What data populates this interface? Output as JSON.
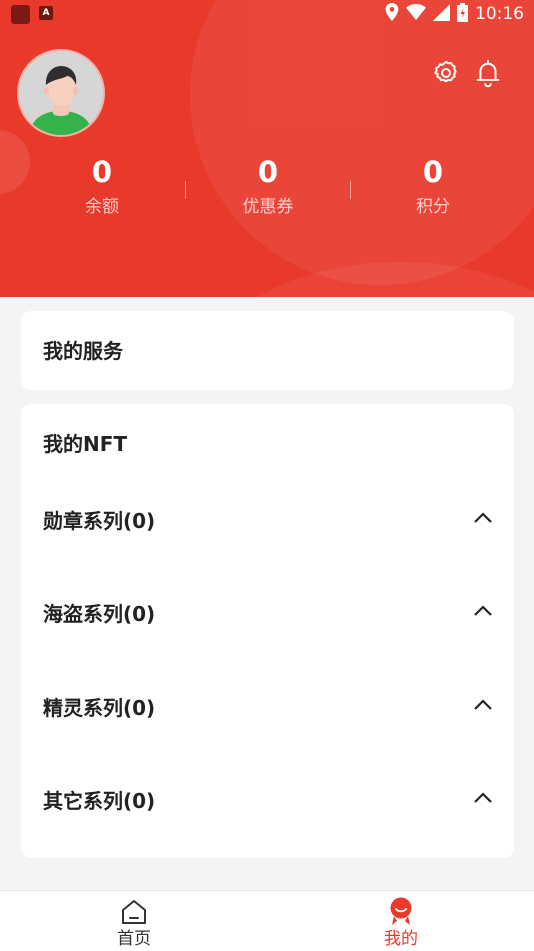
{
  "status_bar": {
    "time": "10:16",
    "app_icon_letter": "A"
  },
  "stats": [
    {
      "value": "0",
      "label": "余额"
    },
    {
      "value": "0",
      "label": "优惠券"
    },
    {
      "value": "0",
      "label": "积分"
    }
  ],
  "service_card": {
    "title": "我的服务"
  },
  "nft_card": {
    "title": "我的NFT",
    "series": [
      {
        "label": "勋章系列(0)"
      },
      {
        "label": "海盗系列(0)"
      },
      {
        "label": "精灵系列(0)"
      },
      {
        "label": "其它系列(0)"
      }
    ]
  },
  "bottom_nav": {
    "home_label": "首页",
    "mine_label": "我的"
  },
  "colors": {
    "brand_red": "#e8392b",
    "nav_active": "#e8392b",
    "nav_inactive": "#333333"
  },
  "icons": [
    "settings-icon",
    "bell-icon",
    "chevron-up-icon",
    "home-icon",
    "mine-icon"
  ]
}
